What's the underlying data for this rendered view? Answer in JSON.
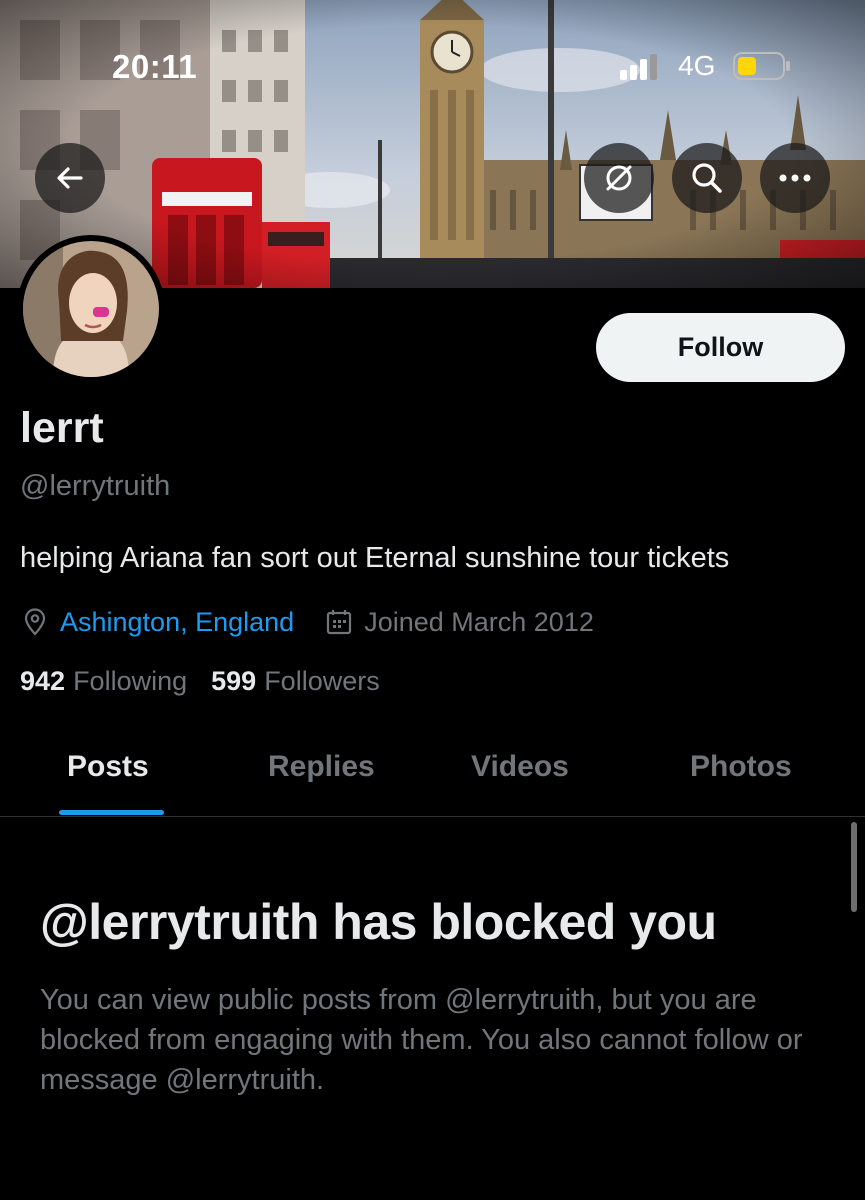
{
  "status_bar": {
    "time": "20:11",
    "network": "4G"
  },
  "header": {
    "back_icon": "arrow-left-icon",
    "actions": [
      "circle-slash-icon",
      "search-icon",
      "more-icon"
    ]
  },
  "profile": {
    "display_name": "lerrt",
    "handle": "@lerrytruith",
    "bio": "helping Ariana fan sort out Eternal sunshine tour tickets",
    "location": "Ashington, England",
    "joined": "Joined March 2012",
    "following_count": "942",
    "following_label": "Following",
    "followers_count": "599",
    "followers_label": "Followers",
    "follow_button": "Follow"
  },
  "tabs": [
    {
      "label": "Posts",
      "active": true
    },
    {
      "label": "Replies",
      "active": false
    },
    {
      "label": "Videos",
      "active": false
    },
    {
      "label": "Photos",
      "active": false
    }
  ],
  "blocked_notice": {
    "title": "@lerrytruith has blocked you",
    "description": "You can view public posts from @lerrytruith, but you are blocked from engaging with them. You also cannot follow or message @lerrytruith."
  },
  "colors": {
    "background": "#000000",
    "accent": "#1d9bf0",
    "secondary_text": "#71767b",
    "battery_fill": "#ffd60a"
  }
}
